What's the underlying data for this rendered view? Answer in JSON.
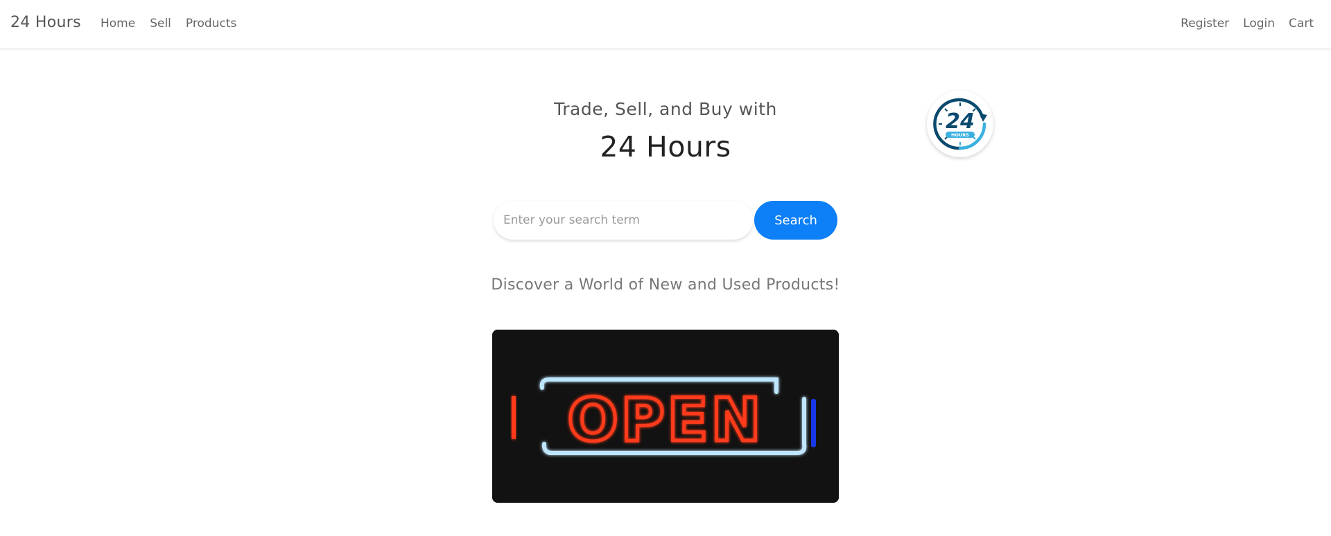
{
  "navbar": {
    "brand": "24 Hours",
    "left_links": [
      "Home",
      "Sell",
      "Products"
    ],
    "right_links": [
      "Register",
      "Login",
      "Cart"
    ]
  },
  "hero": {
    "subtitle": "Trade, Sell, and Buy with",
    "title": "24 Hours",
    "logo_text": "24",
    "logo_subtext": "HOURS"
  },
  "search": {
    "placeholder": "Enter your search term",
    "value": "",
    "button_label": "Search"
  },
  "tagline": "Discover a World of New and Used Products!",
  "sign": {
    "text": "OPEN"
  },
  "colors": {
    "accent": "#0d7ff7",
    "logo_dark": "#0a4a6e",
    "logo_light": "#3bb0e0",
    "sign_red": "#ff3a1a",
    "sign_blue": "#bfe6ff",
    "image_bg": "#121212"
  },
  "icons": {
    "logo": "24-hours-clock-icon"
  }
}
